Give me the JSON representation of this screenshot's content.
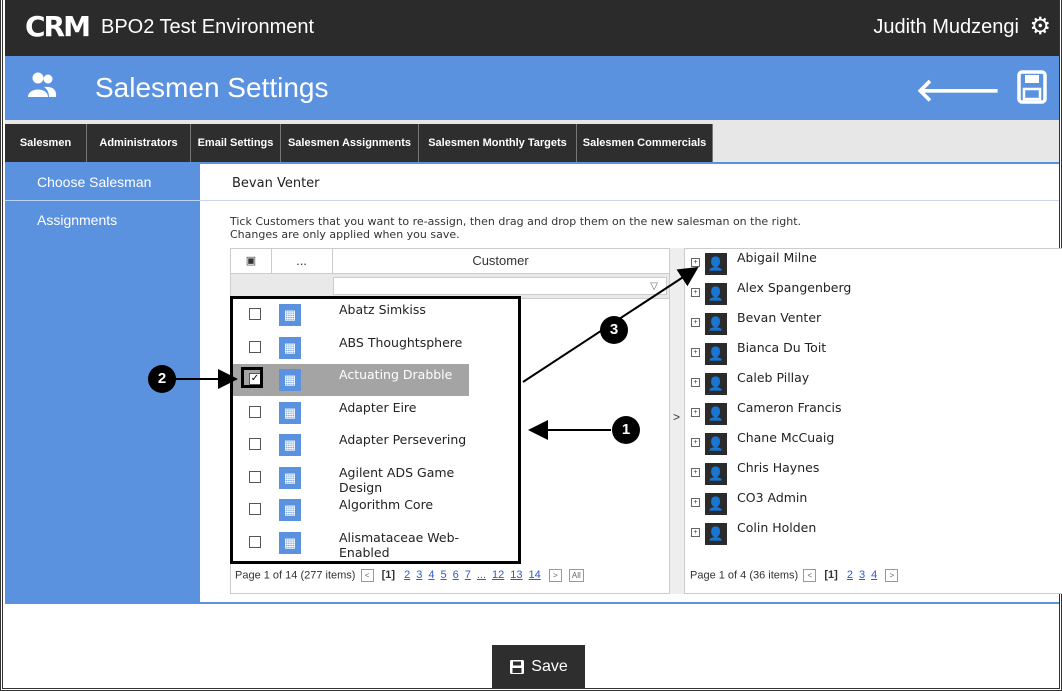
{
  "app": {
    "logo": "CRM",
    "environment": "BPO2 Test Environment",
    "user": "Judith Mudzengi"
  },
  "header": {
    "title": "Salesmen Settings"
  },
  "tabs": [
    "Salesmen",
    "Administrators",
    "Email Settings",
    "Salesmen Assignments",
    "Salesmen Monthly Targets",
    "Salesmen Commercials"
  ],
  "sidebar": {
    "items": [
      "Choose Salesman",
      "Assignments"
    ]
  },
  "main": {
    "selected_salesman": "Bevan Venter",
    "instructions_line1": "Tick Customers that you want to re-assign, then drag and drop them on the new salesman on the right.",
    "instructions_line2": "Changes are only applied when you save."
  },
  "customers_grid": {
    "col_select": "▣",
    "col_menu": "...",
    "col_customer": "Customer",
    "rows": [
      {
        "name": "Abatz Simkiss",
        "checked": false
      },
      {
        "name": "ABS Thoughtsphere",
        "checked": false
      },
      {
        "name": "Actuating Drabble",
        "checked": true
      },
      {
        "name": "Adapter Eire",
        "checked": false
      },
      {
        "name": "Adapter Persevering",
        "checked": false
      },
      {
        "name": "Agilent ADS Game Design",
        "checked": false
      },
      {
        "name": "Algorithm Core",
        "checked": false
      },
      {
        "name": "Alismataceae Web-Enabled",
        "checked": false
      }
    ],
    "pager": {
      "summary": "Page 1 of 14 (277 items)",
      "current": "[1]",
      "pages": [
        "2",
        "3",
        "4",
        "5",
        "6",
        "7",
        "...",
        "12",
        "13",
        "14"
      ],
      "all": "All"
    }
  },
  "salesmen_list": {
    "items": [
      "Abigail Milne",
      "Alex Spangenberg",
      "Bevan Venter",
      "Bianca Du Toit",
      "Caleb Pillay",
      "Cameron Francis",
      "Chane McCuaig",
      "Chris Haynes",
      "CO3 Admin",
      "Colin Holden"
    ],
    "pager": {
      "summary": "Page 1 of 4 (36 items)",
      "current": "[1]",
      "pages": [
        "2",
        "3",
        "4"
      ]
    }
  },
  "gutter_arrow": ">",
  "save_label": "Save",
  "annotations": [
    "1",
    "2",
    "3"
  ],
  "colors": {
    "accent": "#5a92e0",
    "dark": "#2b2b2b",
    "selected_row": "#a4a4a4"
  }
}
